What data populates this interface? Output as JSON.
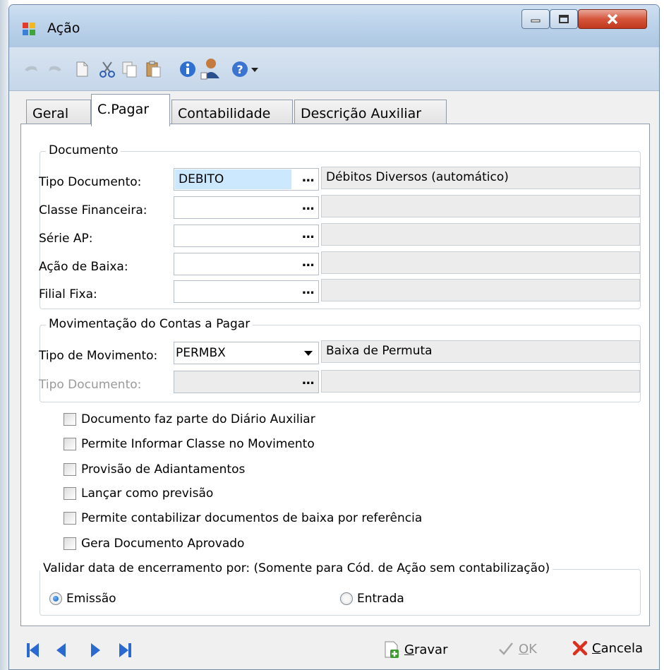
{
  "window": {
    "title": "Ação"
  },
  "toolbar": {
    "icons": [
      "undo-icon",
      "redo-icon",
      "new-icon",
      "cut-icon",
      "copy-icon",
      "paste-icon",
      "info-icon",
      "user-icon",
      "help-icon",
      "help-dropdown-icon"
    ]
  },
  "tabs": [
    {
      "label": "Geral"
    },
    {
      "label": "C.Pagar"
    },
    {
      "label": "Contabilidade"
    },
    {
      "label": "Descrição Auxiliar"
    }
  ],
  "documento": {
    "legend": "Documento",
    "rows": [
      {
        "label": "Tipo Documento:",
        "value": "DEBITO",
        "description": "Débitos Diversos (automático)"
      },
      {
        "label": "Classe Financeira:",
        "value": "",
        "description": ""
      },
      {
        "label": "Série AP:",
        "value": "",
        "description": ""
      },
      {
        "label": "Ação de Baixa:",
        "value": "",
        "description": ""
      },
      {
        "label": "Filial Fixa:",
        "value": "",
        "description": ""
      }
    ],
    "lookup_button": "..."
  },
  "movimentacao": {
    "legend": "Movimentação do Contas a Pagar",
    "tipo_movimento": {
      "label": "Tipo de Movimento:",
      "value": "PERMBX",
      "description": "Baixa de Permuta"
    },
    "tipo_documento": {
      "label": "Tipo Documento:",
      "value": "",
      "description": ""
    }
  },
  "checkboxes": [
    {
      "label": "Documento faz parte do Diário Auxiliar",
      "checked": false
    },
    {
      "label": "Permite Informar Classe no Movimento",
      "checked": false
    },
    {
      "label": "Provisão de Adiantamentos",
      "checked": false
    },
    {
      "label": "Lançar como previsão",
      "checked": false
    },
    {
      "label": "Permite contabilizar documentos de baixa por referência",
      "checked": false
    },
    {
      "label": "Gera Documento Aprovado",
      "checked": false
    }
  ],
  "validar": {
    "legend": "Validar data de encerramento por: (Somente para Cód. de Ação sem contabilização)",
    "options": [
      {
        "label": "Emissão",
        "selected": true
      },
      {
        "label": "Entrada",
        "selected": false
      }
    ]
  },
  "footer": {
    "gravar": "Gravar",
    "ok": "OK",
    "cancela": "Cancela"
  },
  "colors": {
    "selection": "#cce8ff",
    "close_button": "#c0391e",
    "nav_blue": "#2a6ad0"
  }
}
